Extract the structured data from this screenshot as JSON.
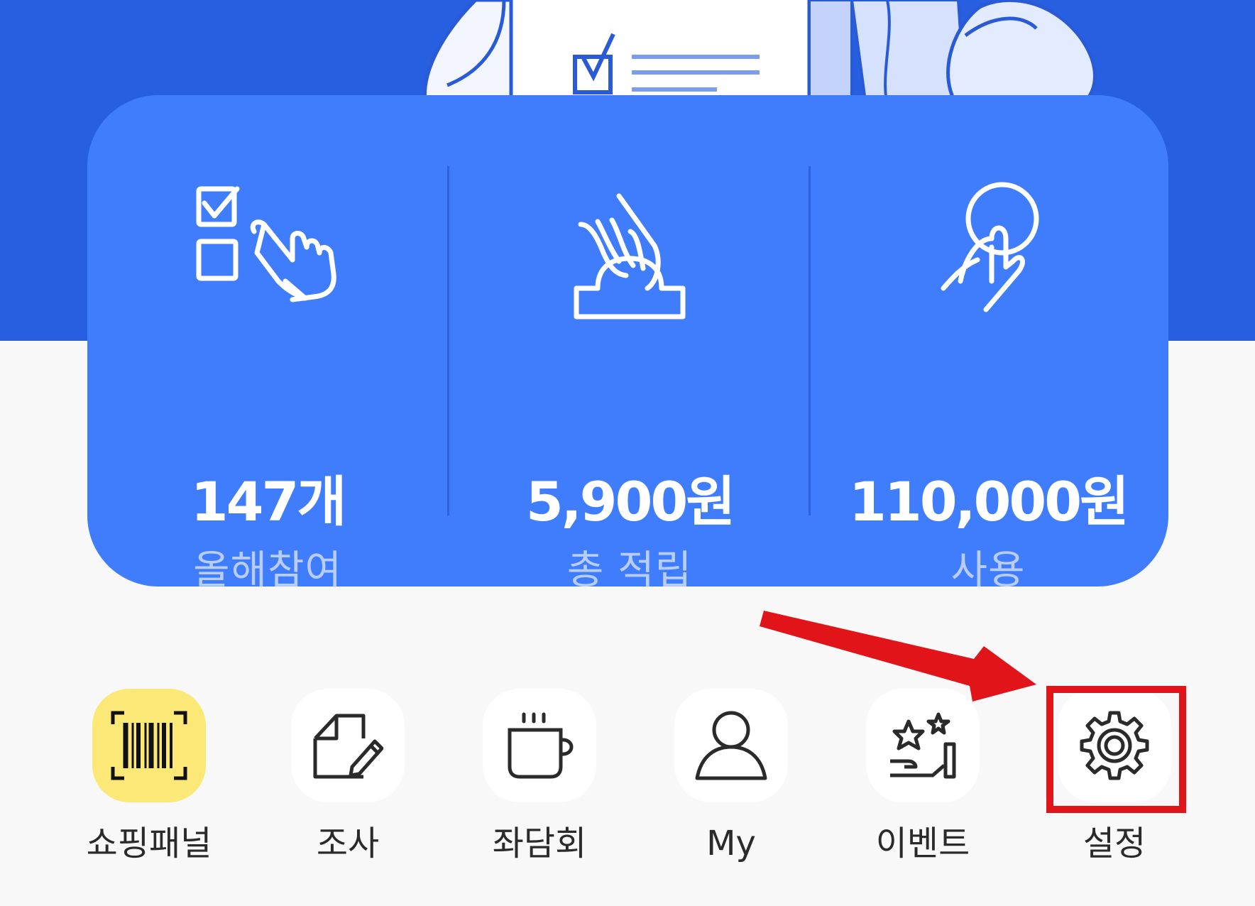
{
  "stats": [
    {
      "icon": "survey-tap-icon",
      "value": "147개",
      "label": "올해참여"
    },
    {
      "icon": "coin-deposit-icon",
      "value": "5,900원",
      "label": "총 적립"
    },
    {
      "icon": "coin-tap-icon",
      "value": "110,000원",
      "label": "사용"
    }
  ],
  "menu": [
    {
      "icon": "barcode-icon",
      "label": "쇼핑패널"
    },
    {
      "icon": "survey-edit-icon",
      "label": "조사"
    },
    {
      "icon": "coffee-cup-icon",
      "label": "좌담회"
    },
    {
      "icon": "user-icon",
      "label": "My"
    },
    {
      "icon": "event-stars-icon",
      "label": "이벤트"
    },
    {
      "icon": "gear-icon",
      "label": "설정"
    }
  ],
  "colors": {
    "hero": "#265fdf",
    "card": "#407dfc",
    "shopping_tile": "#fbe877",
    "annotation": "#e1141a"
  }
}
